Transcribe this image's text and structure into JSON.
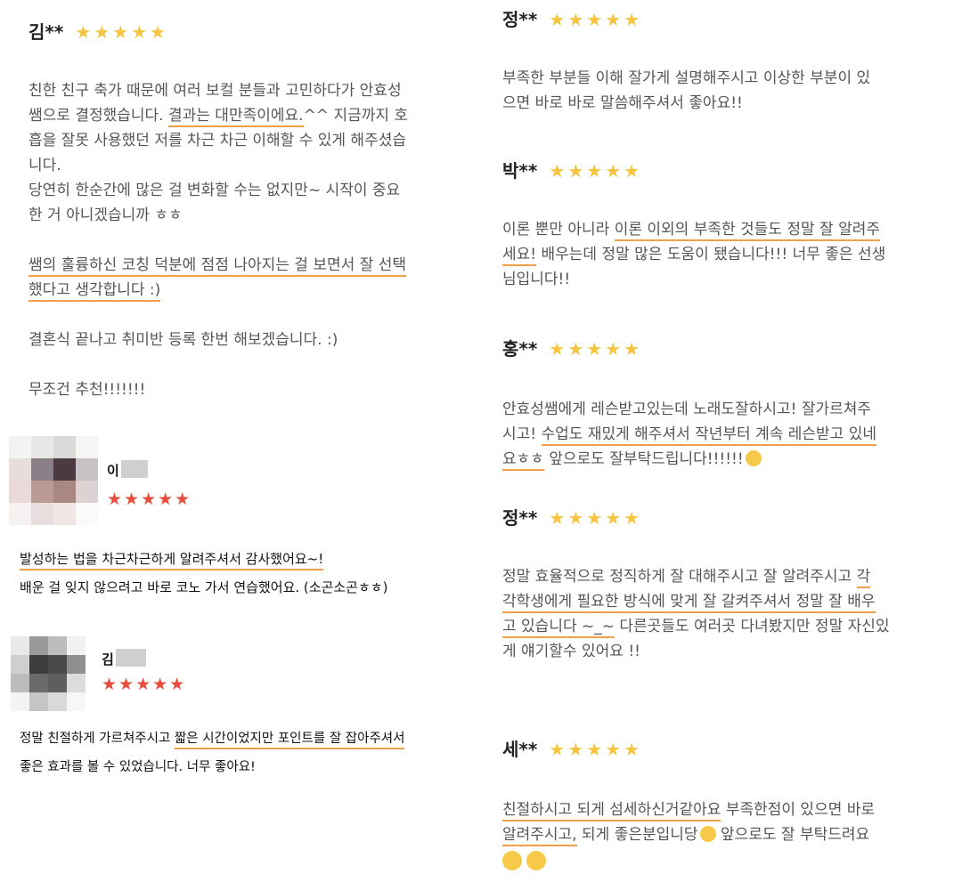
{
  "left": {
    "review1": {
      "name": "김**",
      "stars": "★★★★★",
      "lines": {
        "l1": "친한 친구 축가 때문에 여러 보컬 분들과 고민하다가 안효성",
        "l2a": "쌤으로 결정했습니다. ",
        "l2u": "결과는 대만족이에요.",
        "l2b": "^^ 지금까지 호",
        "l3": "흡을 잘못 사용했던 저를 차근 차근 이해할 수 있게 해주셨습",
        "l4": "니다.",
        "l5": "당연히 한순간에 많은 걸 변화할 수는 없지만~ 시작이 중요",
        "l6": "한 거 아니겠습니까 ㅎㅎ",
        "l7": "쌤의 훌륭하신 코칭 덕분에 점점 나아지는 걸 보면서 잘 선택",
        "l8": "했다고 생각합니다 :)",
        "l9": "결혼식 끝나고 취미반 등록 한번 해보겠습니다. :)",
        "l10": "무조건 추천!!!!!!!"
      }
    },
    "review2": {
      "name": "이",
      "stars": "★★★★★",
      "line1": "발성하는 법을 차근차근하게 알려주셔서 감사했어요~!",
      "line2": "배운 걸 잊지 않으려고 바로 코노 가서 연습했어요. (소곤소곤ㅎㅎ)"
    },
    "review3": {
      "name": "김",
      "stars": "★★★★★",
      "line1a": "정말 친절하게 가르쳐주시고 ",
      "line1u": "짧은 시간이었지만 포인트를 잘 잡아주셔서",
      "line2": "좋은 효과를 볼 수 있었습니다. 너무 좋아요!"
    }
  },
  "right": {
    "review1": {
      "name": "정**",
      "stars": "★★★★★",
      "l1": "부족한 부분들 이해 잘가게 설명해주시고 이상한 부분이 있",
      "l2": "으면 바로 바로 말씀해주셔서 좋아요!!"
    },
    "review2": {
      "name": "박**",
      "stars": "★★★★★",
      "l1a": "이론 뿐만 아니라 ",
      "l1u": "이론 이외의 부족한 것들도 정말 잘 알려주",
      "l2u": "세요!",
      "l2b": " 배우는데 정말 많은 도움이 됐습니다!!! 너무 좋은 선생",
      "l3": "님입니다!!"
    },
    "review3": {
      "name": "홍**",
      "stars": "★★★★★",
      "l1": "안효성쌤에게 레슨받고있는데 노래도잘하시고! 잘가르쳐주",
      "l2a": "시고! ",
      "l2u": "수업도 재밌게 해주셔서 작년부터 계속 레슨받고 있네",
      "l3u": "요ㅎㅎ",
      "l3b": " 앞으로도 잘부탁드립니다!!!!!!"
    },
    "review4": {
      "name": "정**",
      "stars": "★★★★★",
      "l1a": "정말 효율적으로 정직하게 잘 대해주시고 잘 알려주시고 ",
      "l1u": "각",
      "l2u": "각학생에게 필요한 방식에 맞게 잘 갈켜주셔서 정말 잘 배우",
      "l3u": "고 있습니다 ~_~",
      "l3b": " 다른곳들도 여러곳 다녀봤지만 정말 자신있",
      "l4": "게 얘기할수 있어요 !!"
    },
    "review5": {
      "name": "세**",
      "stars": "★★★★★",
      "l1u": "친절하시고 되게 섬세하신거같아요",
      "l1b": " 부족한점이 있으면 바로",
      "l2u": "알려주시고,",
      "l2b": " 되게 좋은분입니당",
      "l2c": "  앞으로도 잘 부탁드려요"
    }
  }
}
